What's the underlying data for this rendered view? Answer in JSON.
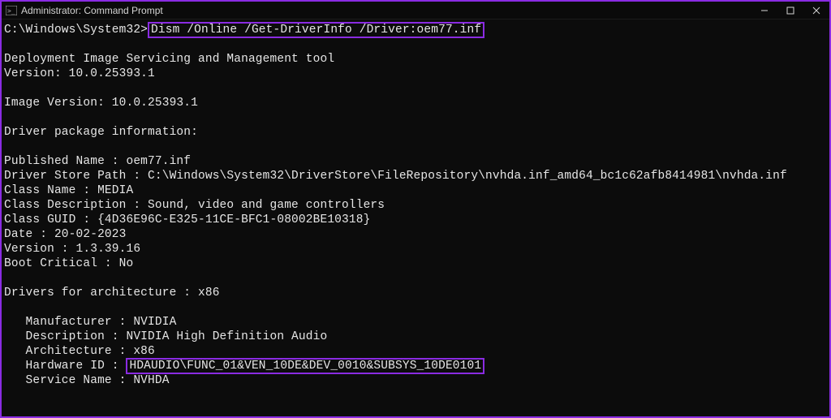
{
  "titlebar": {
    "title": "Administrator: Command Prompt"
  },
  "prompt": {
    "path": "C:\\Windows\\System32>",
    "command": "Dism /Online /Get-DriverInfo /Driver:oem77.inf"
  },
  "output": {
    "tool_line": "Deployment Image Servicing and Management tool",
    "version_line": "Version: 10.0.25393.1",
    "image_version_line": "Image Version: 10.0.25393.1",
    "driver_pkg_header": "Driver package information:",
    "published_name": "Published Name : oem77.inf",
    "driver_store_path": "Driver Store Path : C:\\Windows\\System32\\DriverStore\\FileRepository\\nvhda.inf_amd64_bc1c62afb8414981\\nvhda.inf",
    "class_name": "Class Name : MEDIA",
    "class_description": "Class Description : Sound, video and game controllers",
    "class_guid": "Class GUID : {4D36E96C-E325-11CE-BFC1-08002BE10318}",
    "date": "Date : 20-02-2023",
    "version": "Version : 1.3.39.16",
    "boot_critical": "Boot Critical : No",
    "drivers_arch_header": "Drivers for architecture : x86",
    "manufacturer": "   Manufacturer : NVIDIA",
    "description": "   Description : NVIDIA High Definition Audio",
    "architecture": "   Architecture : x86",
    "hardware_id_label": "   Hardware ID : ",
    "hardware_id_value": "HDAUDIO\\FUNC_01&VEN_10DE&DEV_0010&SUBSYS_10DE0101",
    "service_name": "   Service Name : NVHDA"
  }
}
